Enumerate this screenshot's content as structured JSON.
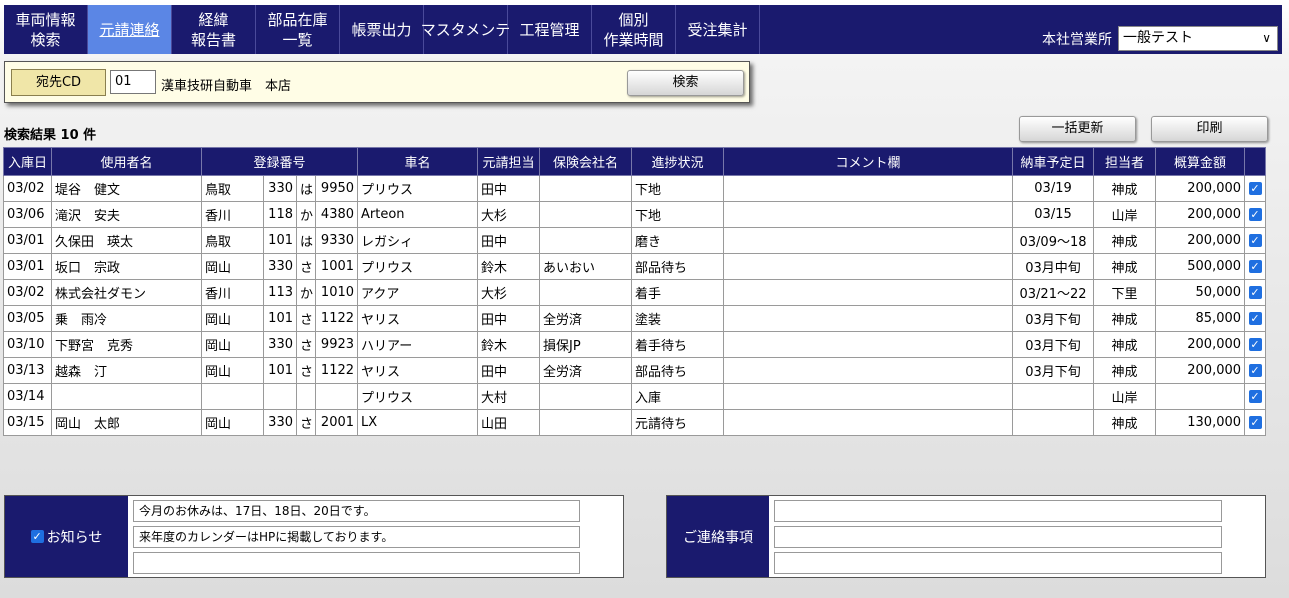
{
  "nav": {
    "tabs": [
      {
        "line1": "車両情報",
        "line2": "検索"
      },
      {
        "line1": "元請連絡",
        "line2": ""
      },
      {
        "line1": "経緯",
        "line2": "報告書"
      },
      {
        "line1": "部品在庫",
        "line2": "一覧"
      },
      {
        "line1": "帳票出力",
        "line2": ""
      },
      {
        "line1": "マスタメンテ",
        "line2": ""
      },
      {
        "line1": "工程管理",
        "line2": ""
      },
      {
        "line1": "個別",
        "line2": "作業時間"
      },
      {
        "line1": "受注集計",
        "line2": ""
      }
    ],
    "active_tab": 1,
    "office_label": "本社営業所",
    "office_value": "一般テスト",
    "office_chevron": "∨"
  },
  "search": {
    "dest_label": "宛先CD",
    "dest_code": "01",
    "dest_name": "漢車技研自動車　本店",
    "search_label": "検索"
  },
  "results": {
    "count_text": "検索結果 10 件",
    "bulk_update_label": "一括更新",
    "print_label": "印刷"
  },
  "table": {
    "headers": [
      "入庫日",
      "使用者名",
      "登録番号",
      "車名",
      "元請担当",
      "保険会社名",
      "進捗状況",
      "コメント欄",
      "納車予定日",
      "担当者",
      "概算金額"
    ],
    "rows": [
      {
        "date": "03/02",
        "user": "堤谷　健文",
        "area": "鳥取",
        "cls": "330",
        "kana": "は",
        "num": "9950",
        "car": "プリウス",
        "contact": "田中",
        "insurer": "",
        "status": "下地",
        "comment": "",
        "delivery": "03/19",
        "staff": "神成",
        "amount": "200,000",
        "checked": true
      },
      {
        "date": "03/06",
        "user": "滝沢　安夫",
        "area": "香川",
        "cls": "118",
        "kana": "か",
        "num": "4380",
        "car": "Arteon",
        "contact": "大杉",
        "insurer": "",
        "status": "下地",
        "comment": "",
        "delivery": "03/15",
        "staff": "山岸",
        "amount": "200,000",
        "checked": true
      },
      {
        "date": "03/01",
        "user": "久保田　瑛太",
        "area": "鳥取",
        "cls": "101",
        "kana": "は",
        "num": "9330",
        "car": "レガシィ",
        "contact": "田中",
        "insurer": "",
        "status": "磨き",
        "comment": "",
        "delivery": "03/09～18",
        "staff": "神成",
        "amount": "200,000",
        "checked": true
      },
      {
        "date": "03/01",
        "user": "坂口　宗政",
        "area": "岡山",
        "cls": "330",
        "kana": "さ",
        "num": "1001",
        "car": "プリウス",
        "contact": "鈴木",
        "insurer": "あいおい",
        "status": "部品待ち",
        "comment": "",
        "delivery": "03月中旬",
        "staff": "神成",
        "amount": "500,000",
        "checked": true
      },
      {
        "date": "03/02",
        "user": "株式会社ダモン",
        "area": "香川",
        "cls": "113",
        "kana": "か",
        "num": "1010",
        "car": "アクア",
        "contact": "大杉",
        "insurer": "",
        "status": "着手",
        "comment": "",
        "delivery": "03/21～22",
        "staff": "下里",
        "amount": "50,000",
        "checked": true
      },
      {
        "date": "03/05",
        "user": "乗　雨冷",
        "area": "岡山",
        "cls": "101",
        "kana": "さ",
        "num": "1122",
        "car": "ヤリス",
        "contact": "田中",
        "insurer": "全労済",
        "status": "塗装",
        "comment": "",
        "delivery": "03月下旬",
        "staff": "神成",
        "amount": "85,000",
        "checked": true
      },
      {
        "date": "03/10",
        "user": "下野宮　克秀",
        "area": "岡山",
        "cls": "330",
        "kana": "さ",
        "num": "9923",
        "car": "ハリアー",
        "contact": "鈴木",
        "insurer": "損保JP",
        "status": "着手待ち",
        "comment": "",
        "delivery": "03月下旬",
        "staff": "神成",
        "amount": "200,000",
        "checked": true
      },
      {
        "date": "03/13",
        "user": "越森　汀",
        "area": "岡山",
        "cls": "101",
        "kana": "さ",
        "num": "1122",
        "car": "ヤリス",
        "contact": "田中",
        "insurer": "全労済",
        "status": "部品待ち",
        "comment": "",
        "delivery": "03月下旬",
        "staff": "神成",
        "amount": "200,000",
        "checked": true
      },
      {
        "date": "03/14",
        "user": "",
        "area": "",
        "cls": "",
        "kana": "",
        "num": "",
        "car": "プリウス",
        "contact": "大村",
        "insurer": "",
        "status": "入庫",
        "comment": "",
        "delivery": "",
        "staff": "山岸",
        "amount": "",
        "checked": true
      },
      {
        "date": "03/15",
        "user": "岡山　太郎",
        "area": "岡山",
        "cls": "330",
        "kana": "さ",
        "num": "2001",
        "car": "LX",
        "contact": "山田",
        "insurer": "",
        "status": "元請待ち",
        "comment": "",
        "delivery": "",
        "staff": "神成",
        "amount": "130,000",
        "checked": true
      }
    ],
    "check_glyph": "✓"
  },
  "notice": {
    "label": "お知らせ",
    "lines": [
      "今月のお休みは、17日、18日、20日です。",
      "来年度のカレンダーはHPに掲載しております。",
      ""
    ]
  },
  "contact_notes": {
    "label": "ご連絡事項",
    "lines": [
      "",
      "",
      ""
    ]
  }
}
